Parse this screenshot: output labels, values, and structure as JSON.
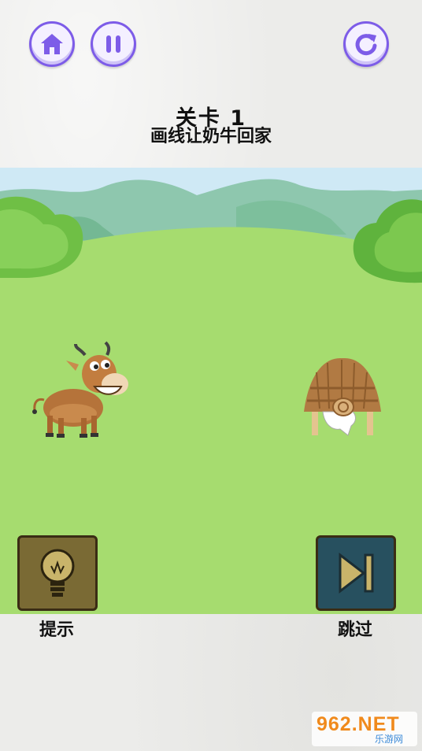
{
  "toolbar": {
    "home_icon": "home-icon",
    "pause_icon": "pause-icon",
    "restart_icon": "restart-icon",
    "accent": "#7d5ce8"
  },
  "level": {
    "title": "关卡 1",
    "instruction": "画线让奶牛回家"
  },
  "scene": {
    "sky": "#cfe9f5",
    "grass": "#a6dc6f",
    "characters": [
      "cow",
      "barn"
    ]
  },
  "actions": {
    "hint_label": "提示",
    "skip_label": "跳过",
    "hint_icon": "lightbulb-icon",
    "skip_icon": "skip-icon"
  },
  "watermark": {
    "brand": "962.NET",
    "sub": "乐游网"
  }
}
